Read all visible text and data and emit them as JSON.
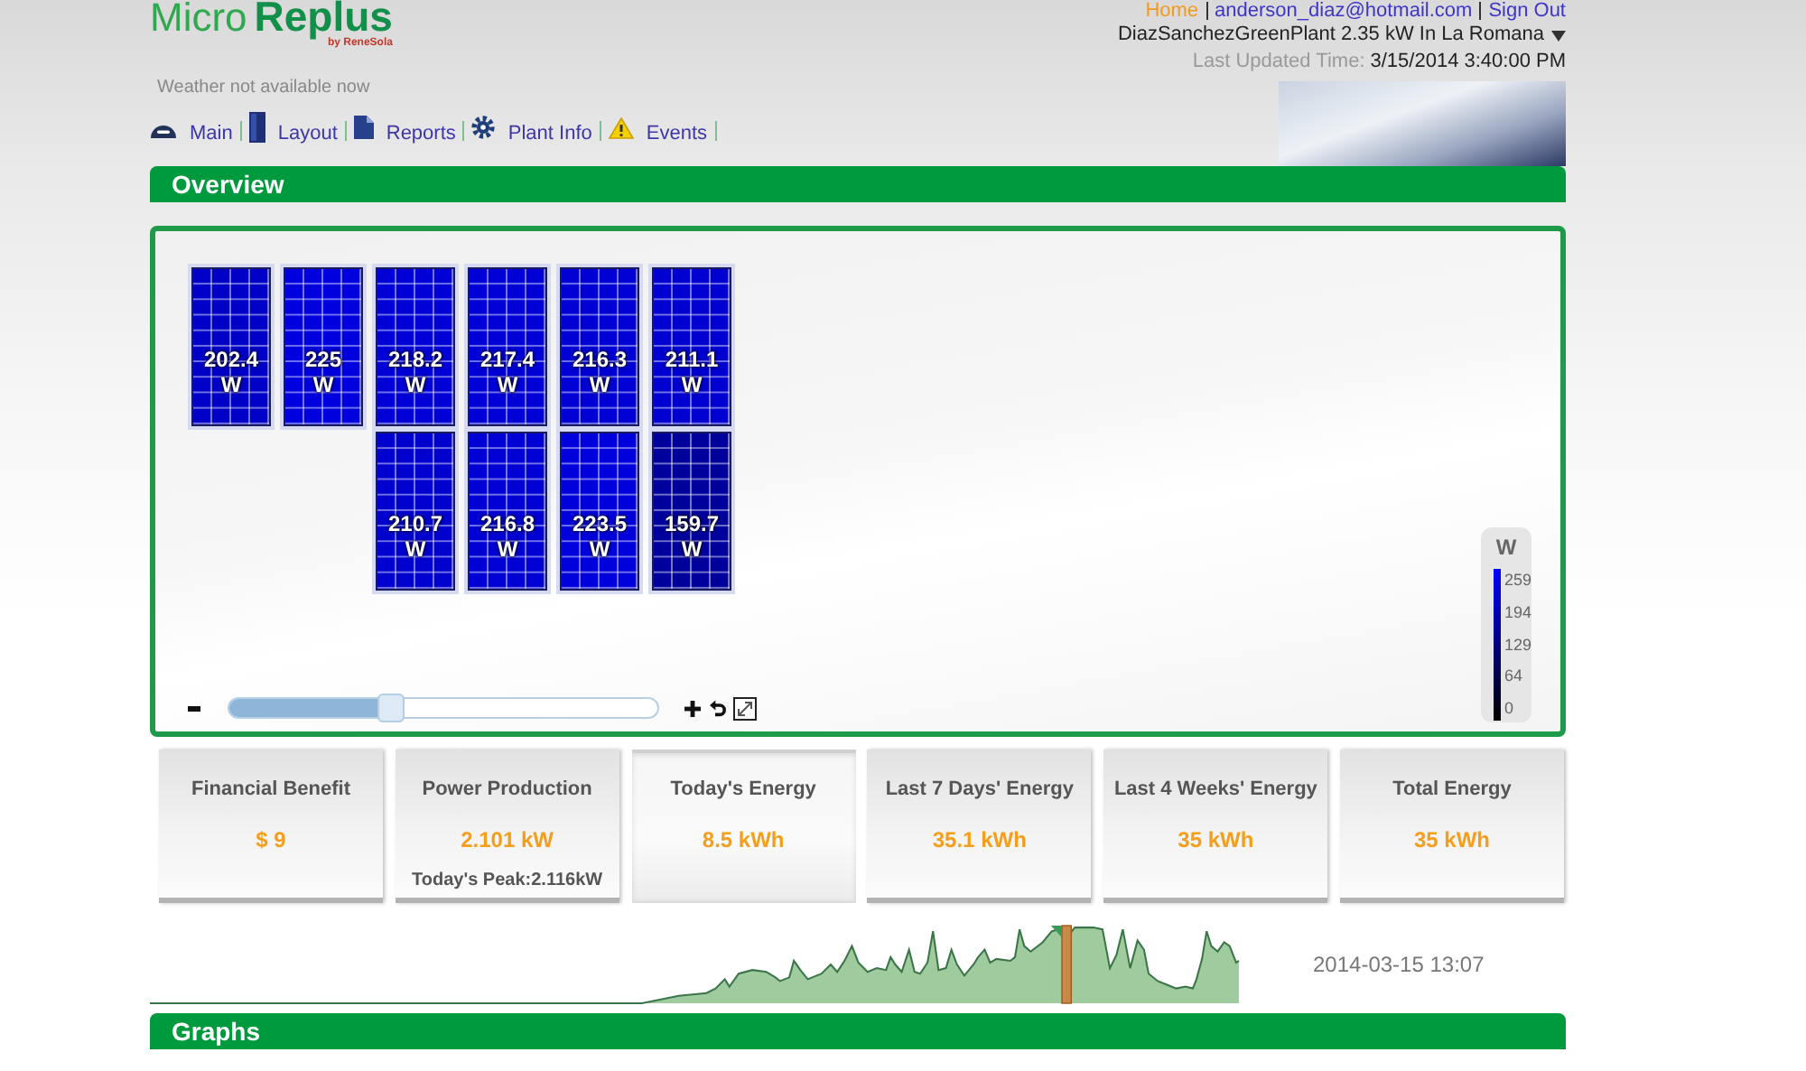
{
  "header": {
    "logo": {
      "prefix": "Micro",
      "name": "Replus",
      "tagline": "by ReneSola"
    },
    "weather": "Weather not available now",
    "nav": [
      {
        "label": "Main"
      },
      {
        "label": "Layout"
      },
      {
        "label": "Reports"
      },
      {
        "label": "Plant Info"
      },
      {
        "label": "Events"
      }
    ],
    "account_links": [
      {
        "label": "Home",
        "selected": true
      },
      {
        "label": "anderson_diaz@hotmail.com",
        "selected": false
      },
      {
        "label": "Sign Out",
        "selected": false
      }
    ],
    "plant_selector": "DiazSanchezGreenPlant 2.35 kW In La Romana",
    "last_updated": {
      "label": "Last Updated Time:",
      "value": "3/15/2014 3:40:00 PM"
    }
  },
  "overview": {
    "title": "Overview",
    "panel_rows": [
      {
        "panels": [
          {
            "reading": "202.4 W",
            "color": "#0000c7"
          },
          {
            "reading": "225 W",
            "color": "#0000de"
          },
          {
            "reading": "218.2 W",
            "color": "#0000d7"
          },
          {
            "reading": "217.4 W",
            "color": "#0000d6"
          },
          {
            "reading": "216.3 W",
            "color": "#0000d5"
          },
          {
            "reading": "211.1 W",
            "color": "#0000d0"
          }
        ]
      },
      {
        "panels": [
          {
            "reading": "210.7 W",
            "color": "#0000cf"
          },
          {
            "reading": "216.8 W",
            "color": "#0000d5"
          },
          {
            "reading": "223.5 W",
            "color": "#0000dc"
          },
          {
            "reading": "159.7 W",
            "color": "#00009d"
          }
        ]
      }
    ],
    "zoom": {
      "level": 0.38
    },
    "legend": {
      "unit": "W",
      "ticks": [
        "259",
        "194",
        "129",
        "64",
        "0"
      ]
    }
  },
  "stats": [
    {
      "title": "Financial Benefit",
      "value": "$ 9",
      "selected": false
    },
    {
      "title": "Power Production",
      "value": "2.101 kW",
      "note": "Today's Peak:2.116kW",
      "selected": false
    },
    {
      "title": "Today's Energy",
      "value": "8.5 kWh",
      "selected": true
    },
    {
      "title": "Last 7 Days' Energy",
      "value": "35.1 kWh",
      "selected": false
    },
    {
      "title": "Last 4 Weeks' Energy",
      "value": "35 kWh",
      "selected": false
    },
    {
      "title": "Total Energy",
      "value": "35 kWh",
      "selected": false
    }
  ],
  "timeline": {
    "timestamp": "2014-03-15 13:07"
  },
  "graphs": {
    "title": "Graphs"
  }
}
